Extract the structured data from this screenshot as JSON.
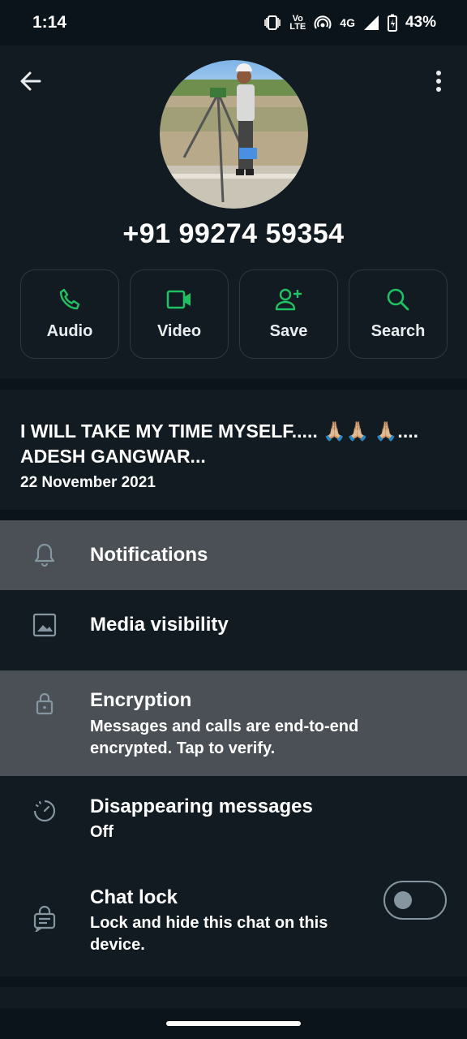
{
  "status_bar": {
    "time": "1:14",
    "volte": "Vo LTE",
    "network": "4G",
    "battery": "43%"
  },
  "contact": {
    "phone": "+91 99274 59354",
    "avatar_icon": "profile-photo-surveyor"
  },
  "actions": [
    {
      "label": "Audio",
      "icon": "phone-icon"
    },
    {
      "label": "Video",
      "icon": "video-icon"
    },
    {
      "label": "Save",
      "icon": "add-person-icon"
    },
    {
      "label": "Search",
      "icon": "search-icon"
    }
  ],
  "about": {
    "text": "I WILL TAKE MY TIME MYSELF..... 🙏🏼🙏🏼 🙏🏼.... ADESH GANGWAR...",
    "date": "22 November 2021"
  },
  "settings": {
    "notifications": "Notifications",
    "media_visibility": "Media visibility",
    "encryption": {
      "title": "Encryption",
      "subtitle": "Messages and calls are end-to-end encrypted. Tap to verify."
    },
    "disappearing": {
      "title": "Disappearing messages",
      "subtitle": "Off"
    },
    "chat_lock": {
      "title": "Chat lock",
      "subtitle": "Lock and hide this chat on this device.",
      "enabled": false
    }
  },
  "colors": {
    "accent": "#21c063",
    "background": "#0b141a",
    "surface": "#111b21",
    "highlight": "#4a5055"
  }
}
